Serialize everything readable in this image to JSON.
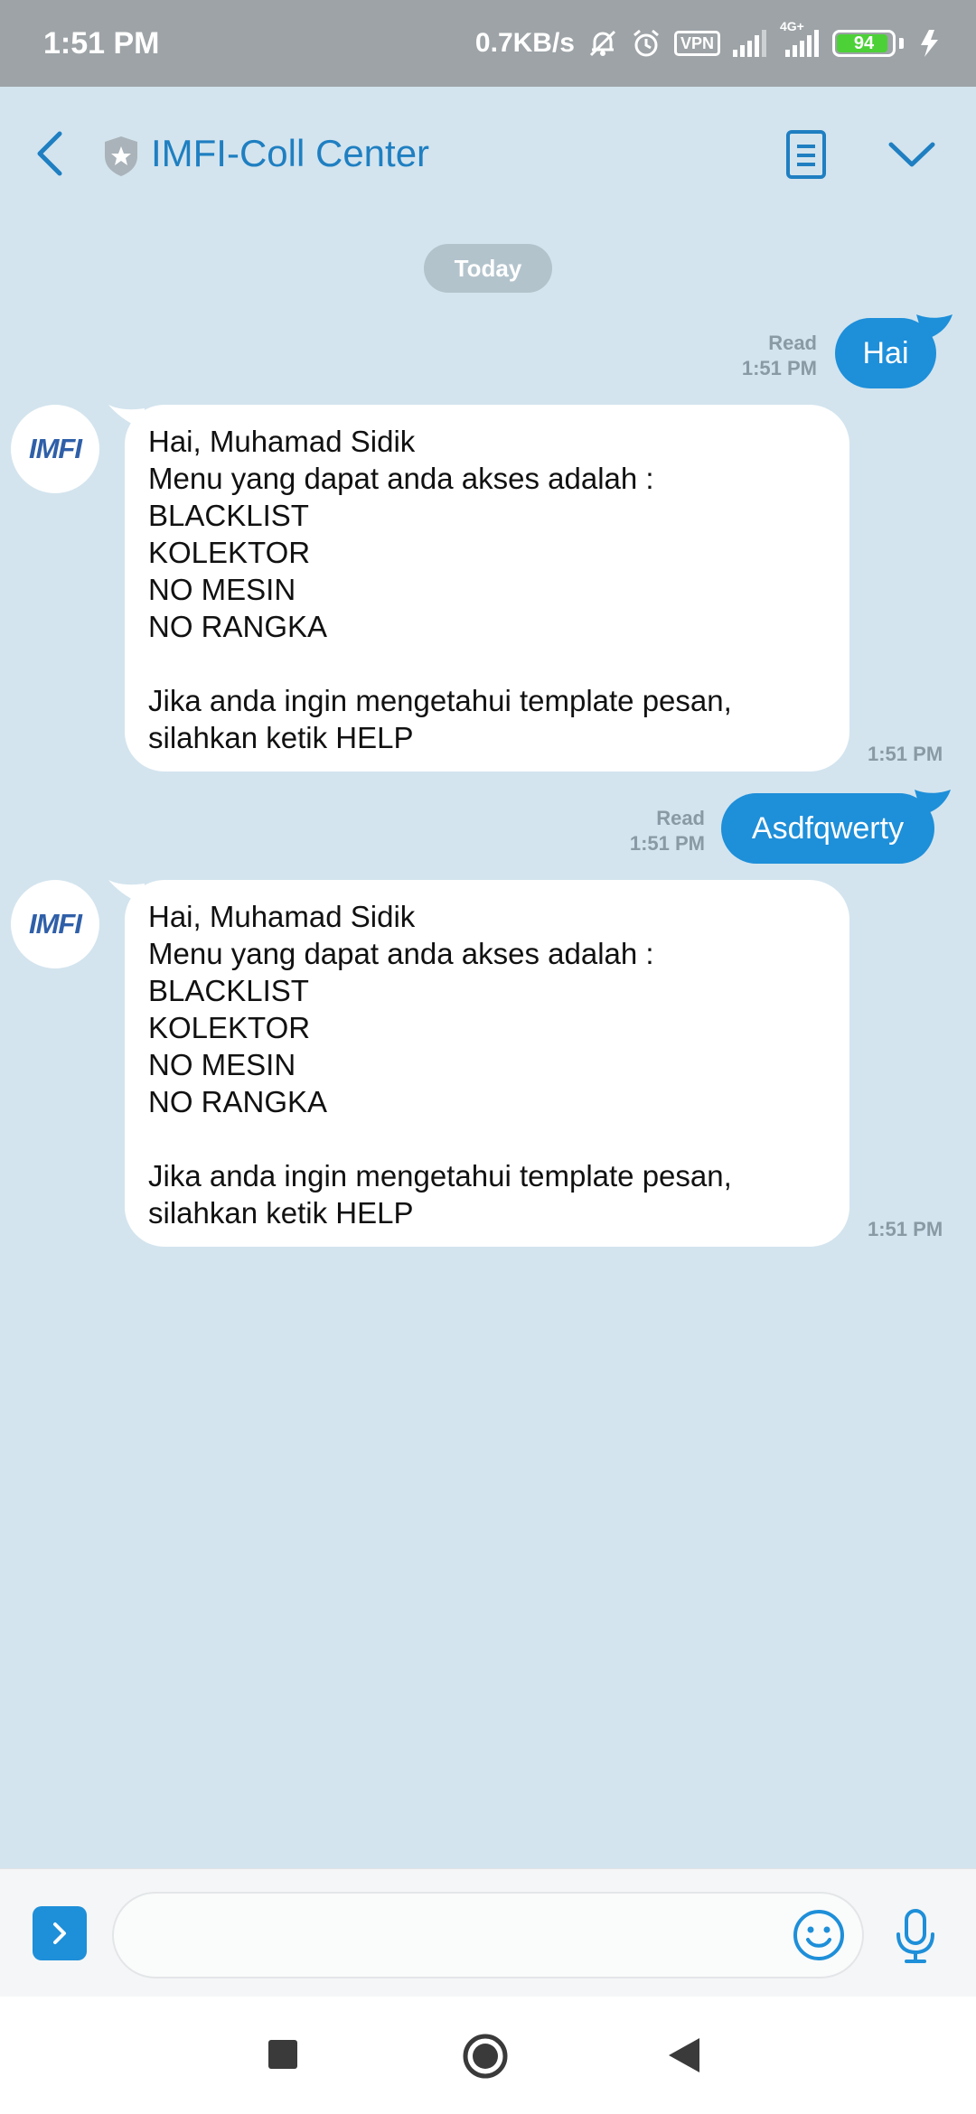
{
  "status_bar": {
    "time": "1:51 PM",
    "net_speed": "0.7KB/s",
    "vpn": "VPN",
    "network_type": "4G+",
    "battery": "94"
  },
  "header": {
    "title": "IMFI-Coll Center"
  },
  "date_separator": "Today",
  "avatar_logo": "IMFI",
  "messages": [
    {
      "direction": "out",
      "text": "Hai",
      "status": "Read",
      "time": "1:51 PM"
    },
    {
      "direction": "in",
      "lines": [
        "Hai, Muhamad Sidik",
        "Menu yang dapat anda akses adalah :",
        "BLACKLIST",
        "KOLEKTOR",
        "NO MESIN",
        "NO RANGKA",
        "",
        "Jika anda ingin mengetahui template pesan,",
        "silahkan ketik HELP"
      ],
      "time": "1:51 PM"
    },
    {
      "direction": "out",
      "text": "Asdfqwerty",
      "status": "Read",
      "time": "1:51 PM"
    },
    {
      "direction": "in",
      "lines": [
        "Hai, Muhamad Sidik",
        "Menu yang dapat anda akses adalah :",
        "BLACKLIST",
        "KOLEKTOR",
        "NO MESIN",
        "NO RANGKA",
        "",
        "Jika anda ingin mengetahui template pesan,",
        "silahkan ketik HELP"
      ],
      "time": "1:51 PM"
    }
  ],
  "input": {
    "value": "",
    "placeholder": ""
  },
  "colors": {
    "accent": "#1e8fd9",
    "background": "#d3e4ee",
    "title": "#1f7fc1"
  },
  "icons": {
    "back": "chevron-left-icon",
    "verified": "shield-star-icon",
    "notes": "notes-icon",
    "menu": "chevron-down-icon",
    "expand": "chevron-right-icon",
    "emoji": "smiley-icon",
    "mic": "microphone-icon"
  }
}
